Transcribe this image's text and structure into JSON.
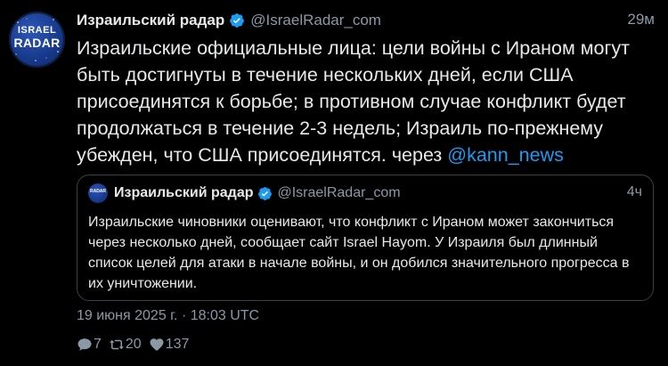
{
  "tweet": {
    "author_name": "Израильский радар",
    "handle": "@IsraelRadar_com",
    "time": "29м",
    "avatar_line1": "ISRAEL",
    "avatar_line2": "RADAR",
    "text": "Израильские официальные лица: цели войны с Ираном могут быть достигнуты в течение нескольких дней, если США присоединятся к борьбе; в противном случае конфликт будет продолжаться в течение 2-3 недель; Израиль по-прежнему убежден, что США присоединятся. через ",
    "mention": "@kann_news",
    "date": "19 июня 2025 г. · 18:03 UTC"
  },
  "quote": {
    "author_name": "Израильский радар",
    "handle": "@IsraelRadar_com",
    "time": "4ч",
    "text": "Израильские чиновники оценивают, что конфликт с Ираном может закончиться через несколько дней, сообщает сайт Israel Hayom. У Израиля был длинный список целей для атаки в начале войны, и он добился значительного прогресса в их уничтожении."
  },
  "actions": {
    "replies": "7",
    "retweets": "20",
    "likes": "137"
  },
  "icons": {
    "reply": "speech-bubble-icon",
    "retweet": "retweet-arrows-icon",
    "like": "heart-icon",
    "verified": "verified-badge-icon"
  },
  "colors": {
    "background": "#000000",
    "text": "#e7e9ea",
    "muted": "#8b98a5",
    "link": "#1d9bf0",
    "border": "#3a3f44"
  }
}
